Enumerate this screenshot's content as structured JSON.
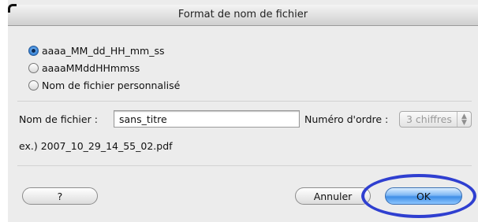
{
  "dialog": {
    "title": "Format de nom de fichier"
  },
  "format_options": [
    {
      "label": "aaaa_MM_dd_HH_mm_ss",
      "selected": true
    },
    {
      "label": "aaaaMMddHHmmss",
      "selected": false
    },
    {
      "label": "Nom de fichier personnalisé",
      "selected": false
    }
  ],
  "filename": {
    "label": "Nom de fichier :",
    "value": "sans_titre"
  },
  "sequence": {
    "label": "Numéro d'ordre :",
    "value": "3 chiffres",
    "enabled": false
  },
  "example": "ex.) 2007_10_29_14_55_02.pdf",
  "buttons": {
    "help_label": "?",
    "cancel_label": "Annuler",
    "ok_label": "OK"
  },
  "colors": {
    "accent": "#3f8ee6",
    "annotation_ring": "#2f3fd0"
  }
}
